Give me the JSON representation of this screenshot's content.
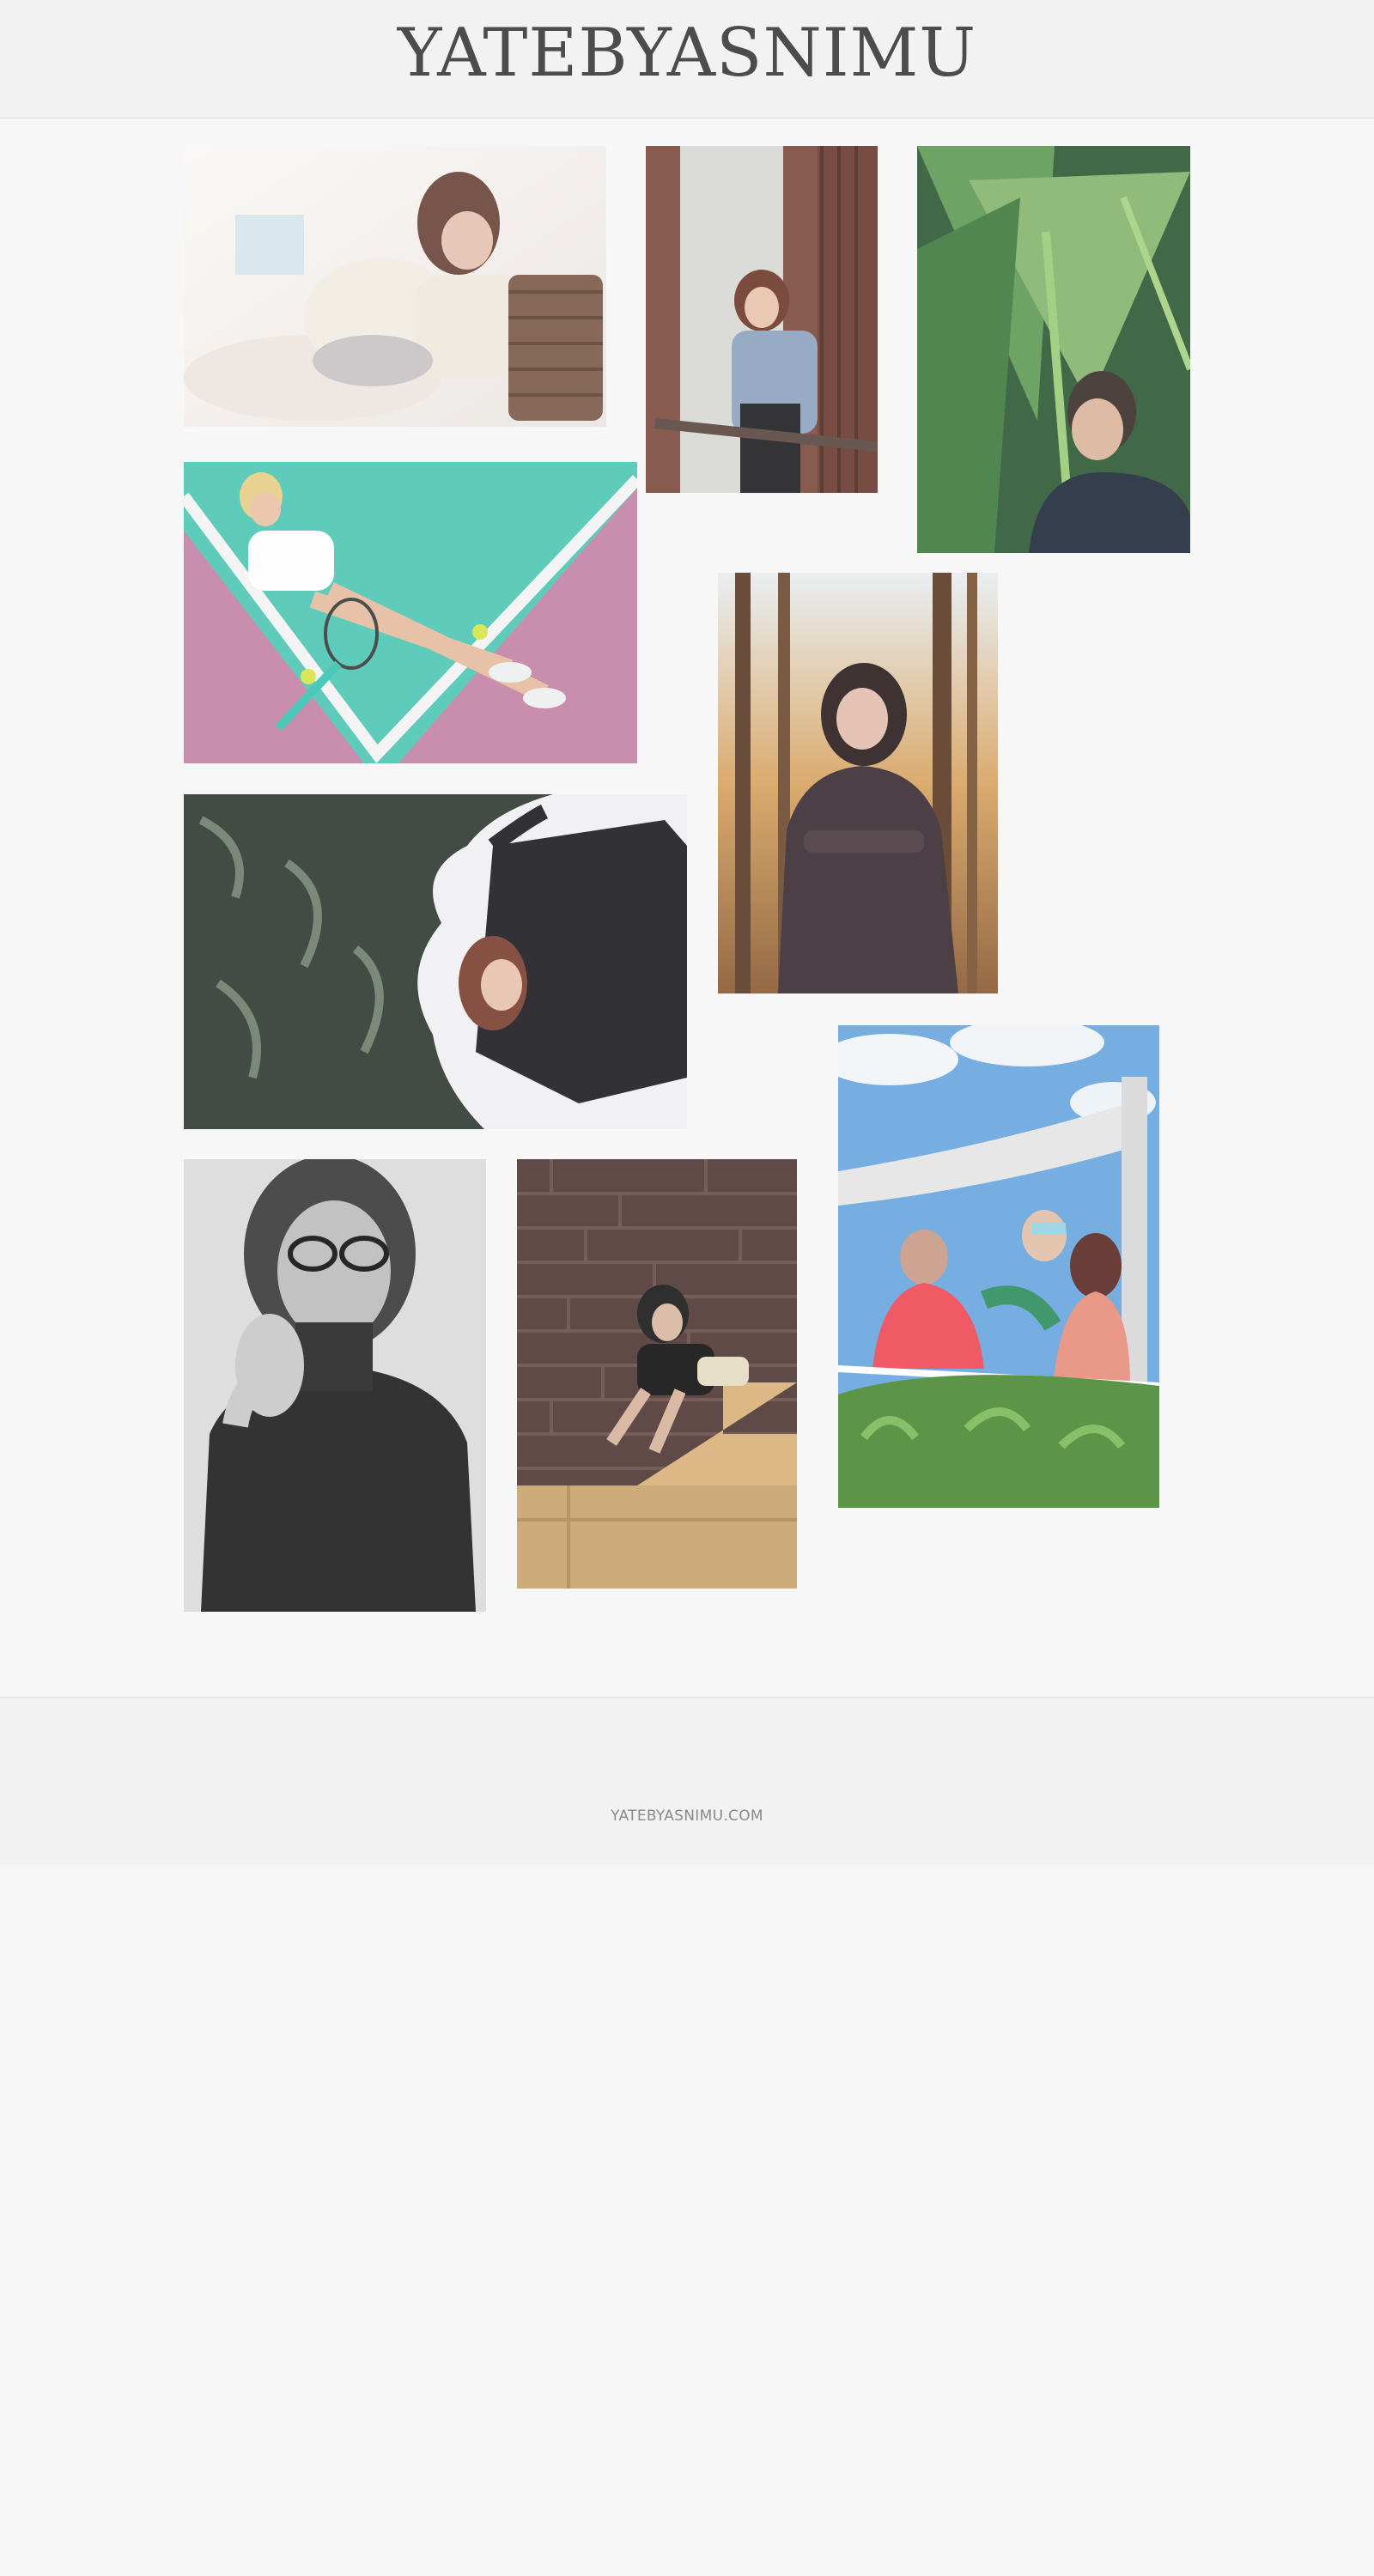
{
  "header": {
    "logo_text": "YATEBYASNIMU"
  },
  "footer": {
    "domain_text": "YATEBYASNIMU.COM"
  },
  "gallery": {
    "photos": [
      {
        "subject": "woman-with-blanket-photo"
      },
      {
        "subject": "woman-denim-jacket-photo"
      },
      {
        "subject": "man-palm-leaves-photo"
      },
      {
        "subject": "tennis-court-photo"
      },
      {
        "subject": "woman-forest-photo"
      },
      {
        "subject": "woman-snow-rocks-photo"
      },
      {
        "subject": "woman-glasses-bw-photo"
      },
      {
        "subject": "woman-brick-stairs-photo"
      },
      {
        "subject": "family-terrace-photo"
      }
    ]
  }
}
